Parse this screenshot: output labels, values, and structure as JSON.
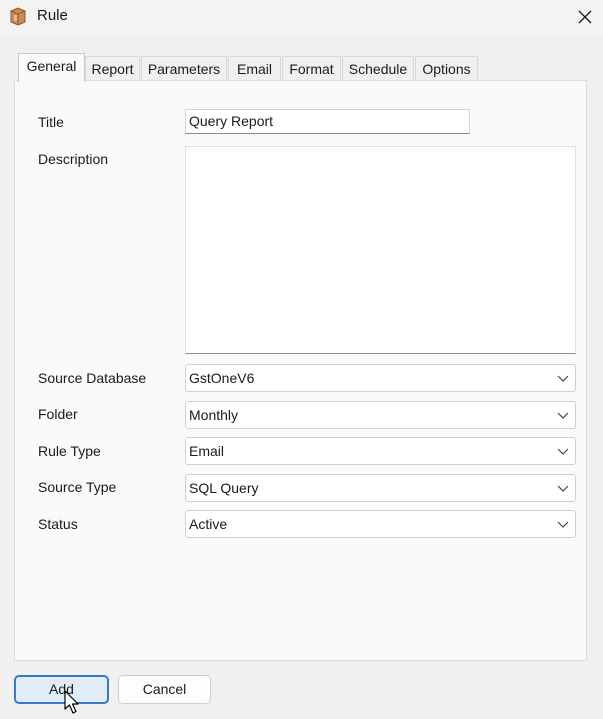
{
  "window": {
    "title": "Rule",
    "icon": "package-icon",
    "close_icon": "close-icon"
  },
  "tabs": [
    {
      "label": "General",
      "active": true
    },
    {
      "label": "Report"
    },
    {
      "label": "Parameters"
    },
    {
      "label": "Email"
    },
    {
      "label": "Format"
    },
    {
      "label": "Schedule"
    },
    {
      "label": "Options"
    }
  ],
  "form": {
    "title_label": "Title",
    "title_value": "Query Report",
    "description_label": "Description",
    "description_value": "",
    "source_database_label": "Source Database",
    "source_database_value": "GstOneV6",
    "folder_label": "Folder",
    "folder_value": "Monthly",
    "rule_type_label": "Rule Type",
    "rule_type_value": "Email",
    "source_type_label": "Source Type",
    "source_type_value": "SQL Query",
    "status_label": "Status",
    "status_value": "Active"
  },
  "buttons": {
    "add": "Add",
    "cancel": "Cancel"
  },
  "colors": {
    "accent": "#3a78c4",
    "add_button_bg": "#e0ecf7"
  }
}
